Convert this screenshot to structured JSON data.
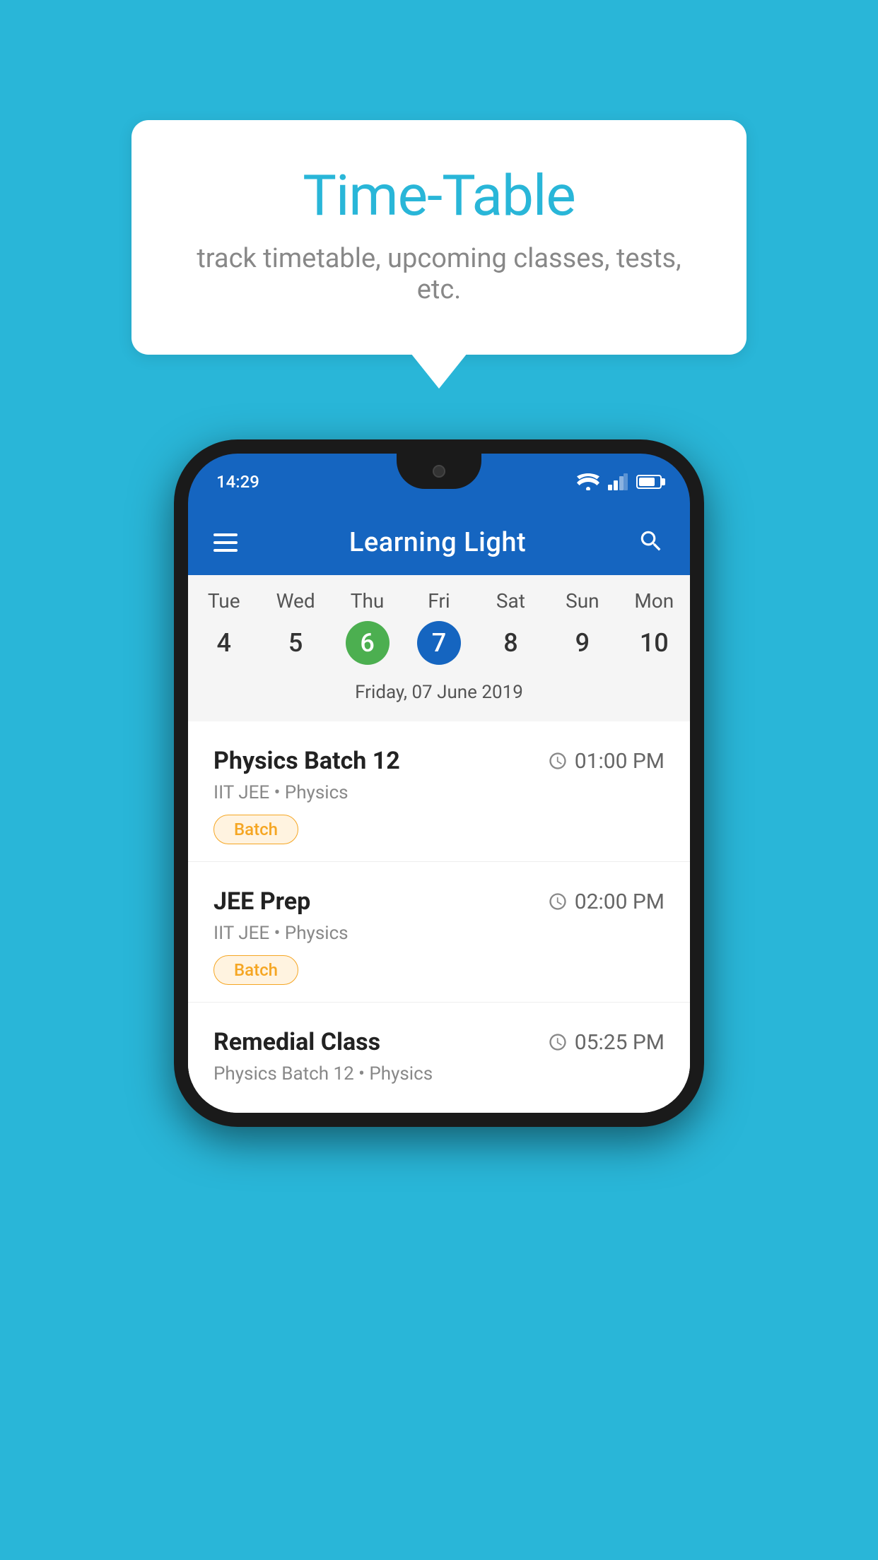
{
  "background_color": "#29b6d8",
  "tooltip": {
    "title": "Time-Table",
    "subtitle": "track timetable, upcoming classes, tests, etc."
  },
  "phone": {
    "status_bar": {
      "time": "14:29"
    },
    "app_header": {
      "title": "Learning Light"
    },
    "calendar": {
      "days": [
        {
          "label": "Tue",
          "num": "4"
        },
        {
          "label": "Wed",
          "num": "5"
        },
        {
          "label": "Thu",
          "num": "6",
          "state": "today"
        },
        {
          "label": "Fri",
          "num": "7",
          "state": "selected"
        },
        {
          "label": "Sat",
          "num": "8"
        },
        {
          "label": "Sun",
          "num": "9"
        },
        {
          "label": "Mon",
          "num": "10"
        }
      ],
      "selected_date": "Friday, 07 June 2019"
    },
    "schedule": [
      {
        "name": "Physics Batch 12",
        "time": "01:00 PM",
        "meta": "IIT JEE • Physics",
        "tag": "Batch"
      },
      {
        "name": "JEE Prep",
        "time": "02:00 PM",
        "meta": "IIT JEE • Physics",
        "tag": "Batch"
      },
      {
        "name": "Remedial Class",
        "time": "05:25 PM",
        "meta": "Physics Batch 12 • Physics",
        "tag": null
      }
    ]
  }
}
